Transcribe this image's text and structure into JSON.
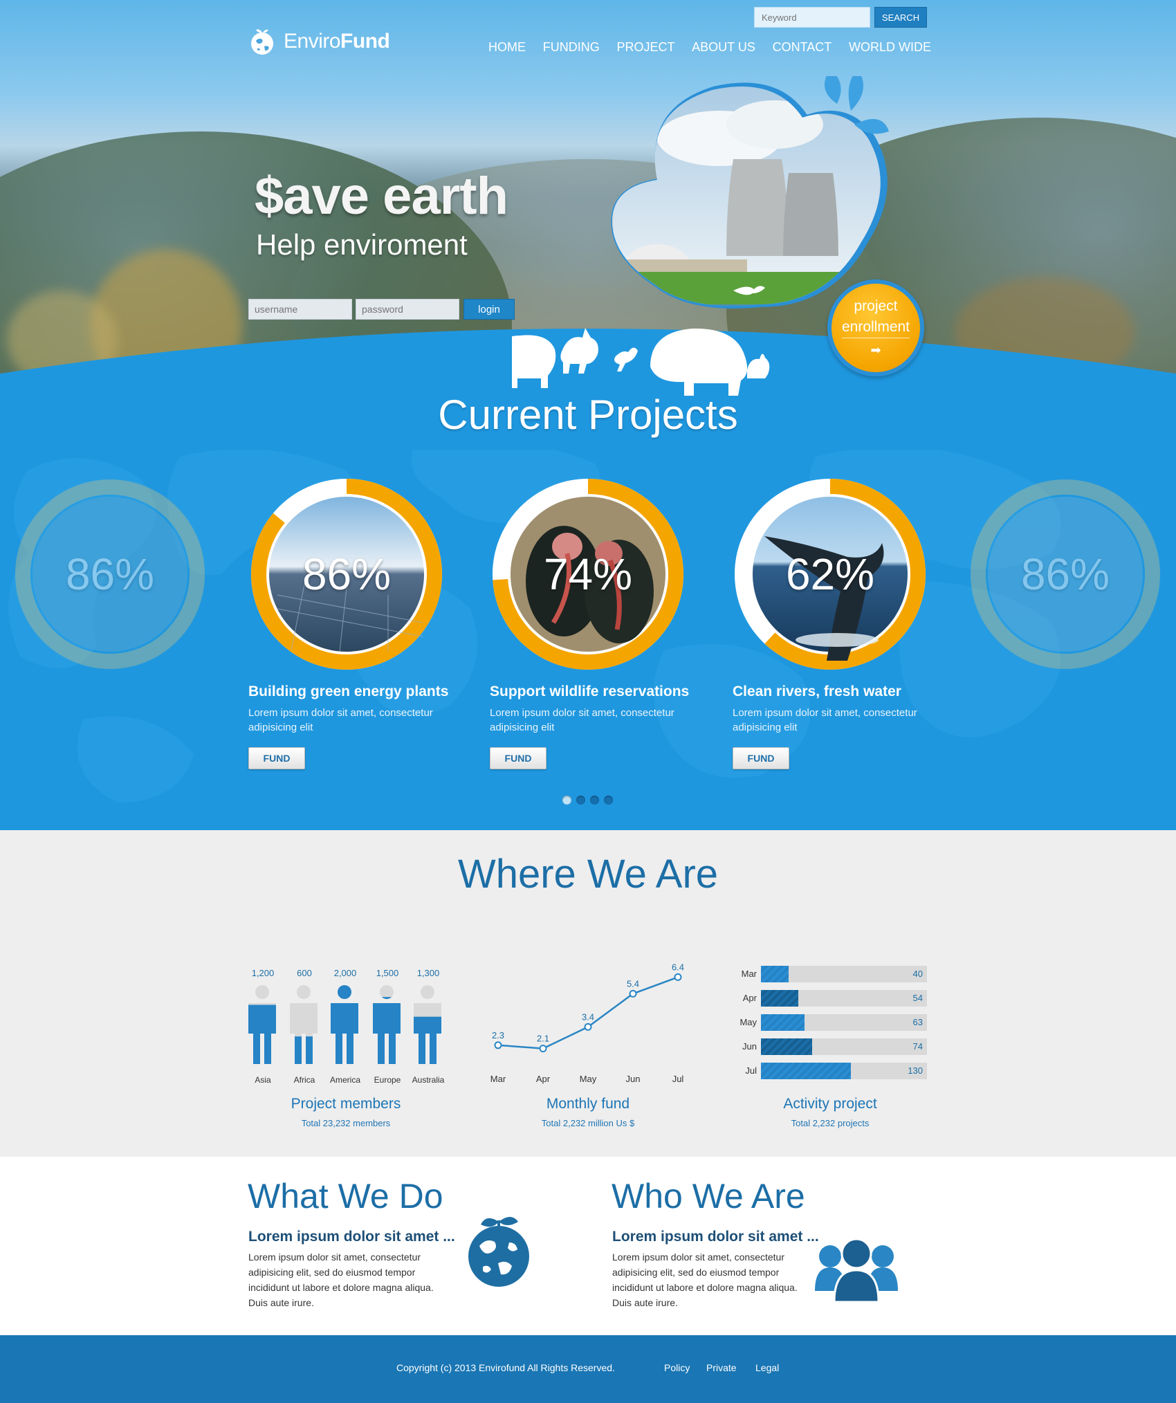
{
  "brand": {
    "name_light": "Enviro",
    "name_bold": "Fund",
    "icon": "globe-leaf-icon"
  },
  "search": {
    "placeholder": "Keyword",
    "button_label": "SEARCH"
  },
  "nav": {
    "items": [
      "HOME",
      "FUNDING",
      "PROJECT",
      "ABOUT US",
      "CONTACT",
      "WORLD WIDE"
    ]
  },
  "hero": {
    "title": "$ave earth",
    "subtitle": "Help enviroment",
    "login": {
      "username_placeholder": "username",
      "password_placeholder": "password",
      "button_label": "login"
    },
    "enroll": {
      "line1": "project",
      "line2": "enrollment",
      "arrow": "➡"
    }
  },
  "projects": {
    "title": "Current Projects",
    "ghost_left_label": "86%",
    "ghost_right_label": "86%",
    "items": [
      {
        "percent": 86,
        "percent_label": "86%",
        "title": "Building green energy plants",
        "description": "Lorem ipsum dolor sit amet, consectetur adipisicing elit",
        "button_label": "FUND",
        "image": "solar-panels"
      },
      {
        "percent": 74,
        "percent_label": "74%",
        "title": "Support wildlife reservations",
        "description": "Lorem ipsum dolor sit amet, consectetur adipisicing elit",
        "button_label": "FUND",
        "image": "ibis-birds"
      },
      {
        "percent": 62,
        "percent_label": "62%",
        "title": "Clean rivers, fresh water",
        "description": "Lorem ipsum dolor sit amet, consectetur adipisicing elit",
        "button_label": "FUND",
        "image": "whale-tail"
      }
    ],
    "pager": {
      "pages": 4,
      "active": 0
    }
  },
  "where": {
    "title": "Where We Are",
    "members": {
      "title": "Project members",
      "subtitle": "Total 23,232 members",
      "people": [
        {
          "region": "Asia",
          "value_label": "1,200",
          "fill": 0.75
        },
        {
          "region": "Africa",
          "value_label": "600",
          "fill": 0.35
        },
        {
          "region": "America",
          "value_label": "2,000",
          "fill": 1.0
        },
        {
          "region": "Europe",
          "value_label": "1,500",
          "fill": 0.85
        },
        {
          "region": "Australia",
          "value_label": "1,300",
          "fill": 0.6
        }
      ]
    },
    "fund": {
      "title": "Monthly fund",
      "subtitle": "Total 2,232 million Us $",
      "chart_data": {
        "type": "line",
        "categories": [
          "Mar",
          "Apr",
          "May",
          "Jun",
          "Jul"
        ],
        "values": [
          2.3,
          2.1,
          3.4,
          5.4,
          6.4
        ],
        "value_labels": [
          "2.3",
          "2.1",
          "3.4",
          "5.4",
          "6.4"
        ],
        "title": "",
        "ylim": [
          1.5,
          6.5
        ],
        "grid": false
      }
    },
    "activity": {
      "title": "Activity project",
      "subtitle": "Total 2,232 projects",
      "chart_data": {
        "type": "bar",
        "orientation": "horizontal",
        "categories": [
          "Mar",
          "Apr",
          "May",
          "Jun",
          "Jul"
        ],
        "values": [
          40,
          54,
          63,
          74,
          130
        ],
        "value_labels": [
          "40",
          "54",
          "63",
          "74",
          "130"
        ],
        "xlim": [
          0,
          240
        ],
        "grid": false
      }
    }
  },
  "what": {
    "title": "What We Do",
    "lead": "Lorem ipsum dolor sit amet ...",
    "body": "Lorem ipsum dolor sit amet, consectetur adipisicing elit, sed do eiusmod tempor incididunt ut labore et dolore magna aliqua. Duis aute irure.",
    "icon": "globe-sprout-icon"
  },
  "who": {
    "title": "Who We Are",
    "lead": "Lorem ipsum dolor sit amet ...",
    "body": "Lorem ipsum dolor sit amet, consectetur adipisicing elit, sed do eiusmod tempor incididunt ut labore et dolore magna aliqua. Duis aute irure.",
    "icon": "people-group-icon"
  },
  "footer": {
    "copyright": "Copyright (c) 2013 Envirofund All Rights Reserved.",
    "links": [
      "Policy",
      "Private",
      "Legal"
    ]
  },
  "colors": {
    "primary_blue": "#1f97df",
    "dark_blue": "#1c6ea6",
    "accent_orange": "#f5a500",
    "footer_blue": "#1a76b4"
  }
}
